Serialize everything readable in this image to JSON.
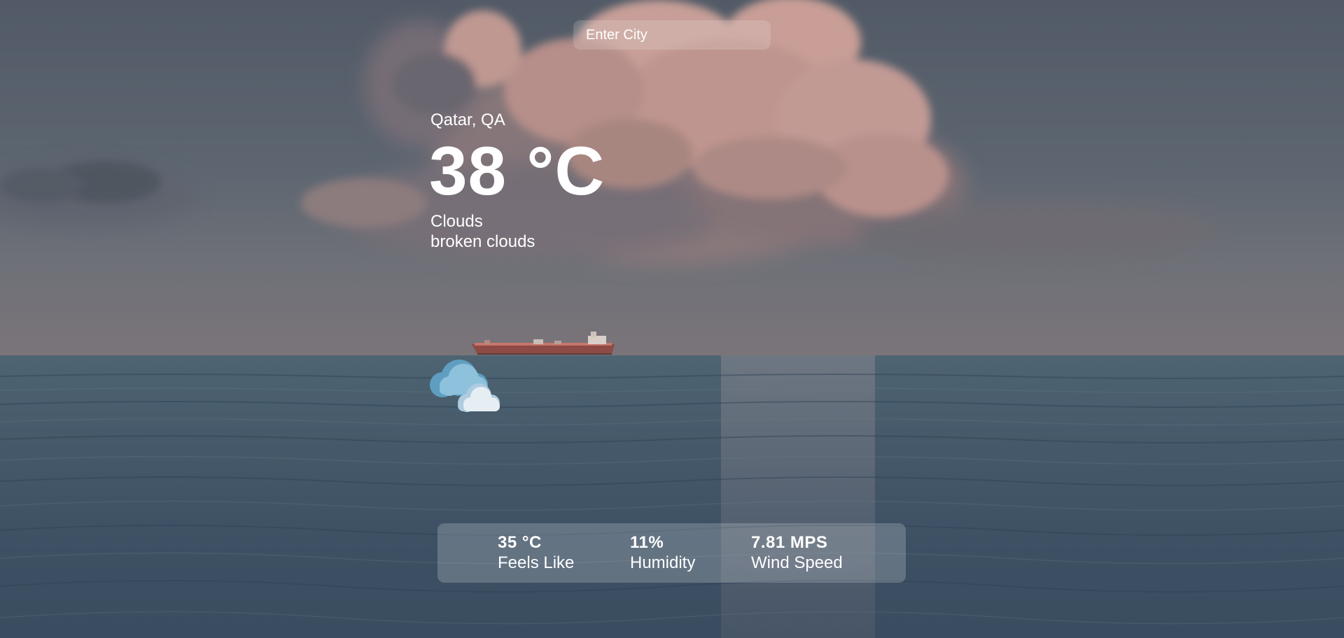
{
  "search": {
    "placeholder": "Enter City"
  },
  "weather": {
    "location": "Qatar, QA",
    "temperature": "38 °C",
    "condition": "Clouds",
    "description": "broken clouds",
    "icon": "broken-clouds-icon"
  },
  "stats": [
    {
      "value": "35 °C",
      "label": "Feels Like"
    },
    {
      "value": "11%",
      "label": "Humidity"
    },
    {
      "value": "7.81 MPS",
      "label": "Wind Speed"
    }
  ],
  "colors": {
    "text": "#ffffff",
    "sky": "#515a66",
    "sea": "#45596a",
    "cloud_highlight": "#c9a29a"
  }
}
